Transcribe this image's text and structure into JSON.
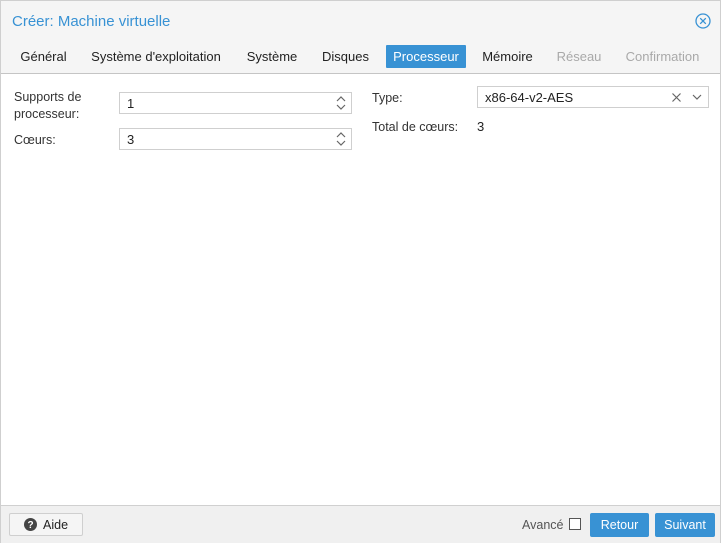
{
  "window": {
    "title": "Créer: Machine virtuelle"
  },
  "tabs": [
    {
      "label": "Général",
      "state": "normal"
    },
    {
      "label": "Système d'exploitation",
      "state": "normal"
    },
    {
      "label": "Système",
      "state": "normal"
    },
    {
      "label": "Disques",
      "state": "normal"
    },
    {
      "label": "Processeur",
      "state": "active"
    },
    {
      "label": "Mémoire",
      "state": "normal"
    },
    {
      "label": "Réseau",
      "state": "disabled"
    },
    {
      "label": "Confirmation",
      "state": "disabled"
    }
  ],
  "form": {
    "sockets_label": "Supports de processeur:",
    "sockets_value": "1",
    "cores_label": "Cœurs:",
    "cores_value": "3",
    "type_label": "Type:",
    "type_value": "x86-64-v2-AES",
    "total_label": "Total de cœurs:",
    "total_value": "3"
  },
  "footer": {
    "help_label": "Aide",
    "advanced_label": "Avancé",
    "advanced_checked": false,
    "back_label": "Retour",
    "next_label": "Suivant"
  },
  "colors": {
    "accent": "#3892d4",
    "disabled": "#a9a9a9"
  }
}
